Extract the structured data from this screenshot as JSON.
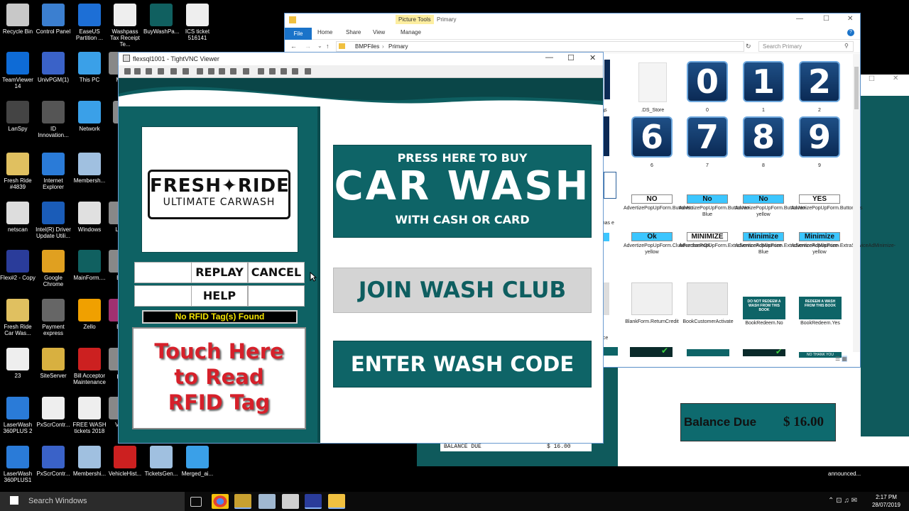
{
  "desktop": {
    "icons": [
      {
        "label": "Recycle Bin",
        "color": "#c8c8c8"
      },
      {
        "label": "Control Panel",
        "color": "#3b7fd0"
      },
      {
        "label": "EaseUS Partition ...",
        "color": "#1d6fd6"
      },
      {
        "label": "Washpass Tax Receipt Te...",
        "color": "#eeeeee"
      },
      {
        "label": "BuyWashPa...",
        "color": "#106060"
      },
      {
        "label": "ICS ticket 516141",
        "color": "#eeeeee"
      },
      {
        "label": "TeamViewer 14",
        "color": "#0e6bd6"
      },
      {
        "label": "UnivPGM(1)",
        "color": "#3a62c8"
      },
      {
        "label": "This PC",
        "color": "#3aa0e8"
      },
      {
        "label": "Me",
        "color": "#888888"
      },
      {
        "label": "LanSpy",
        "color": "#444444"
      },
      {
        "label": "ID Innovation...",
        "color": "#555555"
      },
      {
        "label": "Network",
        "color": "#3aa0e8"
      },
      {
        "label": "si",
        "color": "#888888"
      },
      {
        "label": "Fresh Ride #4839",
        "color": "#e0c060"
      },
      {
        "label": "Internet Explorer",
        "color": "#2a7bd8"
      },
      {
        "label": "Membersh...",
        "color": "#a0c0e0"
      },
      {
        "label": "netscan",
        "color": "#dddddd"
      },
      {
        "label": "Intel(R) Driver Update Utili...",
        "color": "#1a5cb8"
      },
      {
        "label": "Windows",
        "color": "#e0e0e0"
      },
      {
        "label": "Log",
        "color": "#888888"
      },
      {
        "label": "Flex#2 - Copy",
        "color": "#2a3c9a"
      },
      {
        "label": "Google Chrome",
        "color": "#e0a020"
      },
      {
        "label": "MainForm....",
        "color": "#106060"
      },
      {
        "label": "Bu",
        "color": "#888888"
      },
      {
        "label": "Fresh Ride Car Was...",
        "color": "#e0c060"
      },
      {
        "label": "Payment express",
        "color": "#666666"
      },
      {
        "label": "Zello",
        "color": "#f0a000"
      },
      {
        "label": "Bu",
        "color": "#a03070"
      },
      {
        "label": "23",
        "color": "#eeeeee"
      },
      {
        "label": "SiteServer",
        "color": "#d8b040"
      },
      {
        "label": "Bill Acceptor Maintenance",
        "color": "#cc2020"
      },
      {
        "label": "pu",
        "color": "#888888"
      },
      {
        "label": "LaserWash 360PLUS 2",
        "color": "#2a7bd8"
      },
      {
        "label": "PxScrContr...",
        "color": "#eeeeee"
      },
      {
        "label": "FREE WASH tickets 2018",
        "color": "#eeeeee"
      },
      {
        "label": "Veh",
        "color": "#888888"
      },
      {
        "label": "LaserWash 360PLUS1",
        "color": "#2a7bd8"
      },
      {
        "label": "PxScrContr...",
        "color": "#3a62c8"
      },
      {
        "label": "Membershi...",
        "color": "#a0c0e0"
      },
      {
        "label": "VehicleHist...",
        "color": "#cc2020"
      },
      {
        "label": "TicketsGen...",
        "color": "#a0c0e0"
      },
      {
        "label": "Merged_ai...",
        "color": "#3aa0e8"
      }
    ]
  },
  "taskbar": {
    "search_placeholder": "Search Windows",
    "time": "2:17 PM",
    "date": "28/07/2019"
  },
  "explorer": {
    "title": "Primary",
    "picture_tools": "Picture Tools",
    "tabs": [
      "File",
      "Home",
      "Share",
      "View",
      "Manage"
    ],
    "breadcrumb": [
      "BMPFiles",
      "Primary"
    ],
    "search_placeholder": "Search Primary",
    "items": [
      {
        "caption": "ons"
      },
      {
        "caption": ".DS_Store"
      },
      {
        "digit": "0",
        "caption": "0"
      },
      {
        "digit": "1",
        "caption": "1"
      },
      {
        "digit": "2",
        "caption": "2"
      },
      {
        "digit": "6",
        "caption": "6"
      },
      {
        "digit": "7",
        "caption": "7"
      },
      {
        "digit": "8",
        "caption": "8"
      },
      {
        "digit": "9",
        "caption": "9"
      },
      {
        "btn": "NO",
        "caption": "AdvertizePopUpForm.ButtonNo"
      },
      {
        "btn": "No",
        "caption": "AdvertizePopUpForm.ButtonNo-Blue"
      },
      {
        "btn": "No",
        "caption": "AdvertizePopUpForm.ButtonNo-yellow"
      },
      {
        "btn": "YES",
        "caption": "AdvertizePopUpForm.ButtonYes"
      },
      {
        "btn": "Ok",
        "caption": "AdvertizePopUpForm.ClubPurchaseOK-yellow"
      },
      {
        "btn": "MINIMIZE",
        "caption": "AdvertizePopUpForm.ExtraServiceAdMinimize"
      },
      {
        "btn": "Minimize",
        "caption": "AdvertizePopUpForm.ExtraServiceAdMinimize-Blue"
      },
      {
        "btn": "Minimize",
        "caption": "AdvertizePopUpForm.ExtraServiceAdMinimize-yellow"
      },
      {
        "caption": "BlankForm.ReturnCredit"
      },
      {
        "caption": "BookCustomerActivate"
      },
      {
        "caption": "BookRedeem.No",
        "thumb_text": "DO NOT REDEEM A WASH FROM THIS BOOK"
      },
      {
        "caption": "BookRedeem.Yes",
        "thumb_text": "REDEEM A WASH FROM THIS BOOK"
      },
      {
        "caption": "NO THANK YOU"
      }
    ],
    "left_partial_captions": [
      "pUp-",
      "urchas e",
      "Proce"
    ]
  },
  "back_window": {
    "balance_label": "Balance Due",
    "balance_value": "$ 16.00",
    "receipt_label": "BALANCE DUE",
    "receipt_value": "$ 16.00",
    "announced": "announced..."
  },
  "vnc": {
    "title": "flexsql1001 - TightVNC Viewer",
    "kiosk": {
      "logo_line1": "FRESH",
      "logo_line1b": "RIDE",
      "logo_line2": "ULTIMATE CARWASH",
      "replay": "REPLAY",
      "cancel": "CANCEL",
      "help": "HELP",
      "rfid_status": "No RFID Tag(s) Found",
      "touch_line1": "Touch Here",
      "touch_line2": "to Read",
      "touch_line3": "RFID Tag",
      "buy_top": "PRESS HERE TO BUY",
      "buy_main": "CAR WASH",
      "buy_bottom": "WITH CASH OR CARD",
      "join": "JOIN WASH CLUB",
      "enter": "ENTER WASH CODE"
    }
  }
}
